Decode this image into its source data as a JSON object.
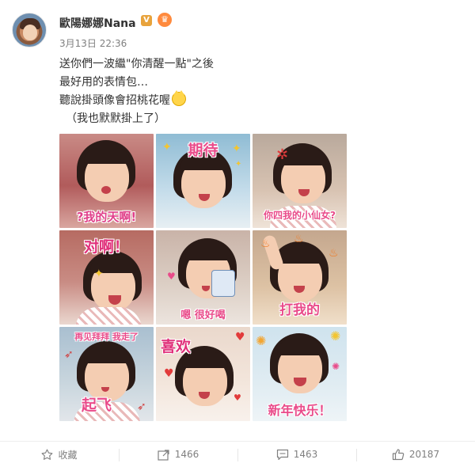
{
  "post": {
    "username": "歐陽娜娜Nana",
    "verified_badge": "V",
    "timestamp": "3月13日 22:36",
    "text_lines": [
      "送你們一波繼\"你清醒一點\"之後",
      "最好用的表情包…",
      "聽說掛頭像會招桃花喔",
      "（我也默默掛上了）"
    ]
  },
  "images": [
    {
      "caption": "?我的天啊!",
      "caption_color": "#e0408a"
    },
    {
      "caption": "期待",
      "caption_color": "#e94b8a"
    },
    {
      "caption": "你四我的小仙女?",
      "caption_color": "#e94b8a"
    },
    {
      "caption": "对啊！",
      "caption_color": "#e0307a"
    },
    {
      "caption": "嗯 很好喝",
      "caption_color": "#e94b8a"
    },
    {
      "caption": "打我的",
      "caption_color": "#e94b8a"
    },
    {
      "caption": "再见拜拜 我走了",
      "caption_color": "#e94b8a"
    },
    {
      "caption": "喜欢",
      "caption_color": "#e0307a"
    },
    {
      "caption": "新年快乐！",
      "caption_color": "#e94b8a"
    }
  ],
  "actions": {
    "favorite_label": "收藏",
    "repost_count": "1466",
    "comment_count": "1463",
    "like_count": "20187"
  },
  "colors": {
    "verified": "#e8a33c",
    "meta_gray": "#808080",
    "caption_pink": "#e94b8a"
  },
  "icons": {
    "favorite": "star-outline-icon",
    "repost": "share-arrow-icon",
    "comment": "comment-bubble-icon",
    "like": "thumbs-up-icon",
    "crown": "crown-badge-icon",
    "cat_emoji": "cat-face-emoji"
  }
}
